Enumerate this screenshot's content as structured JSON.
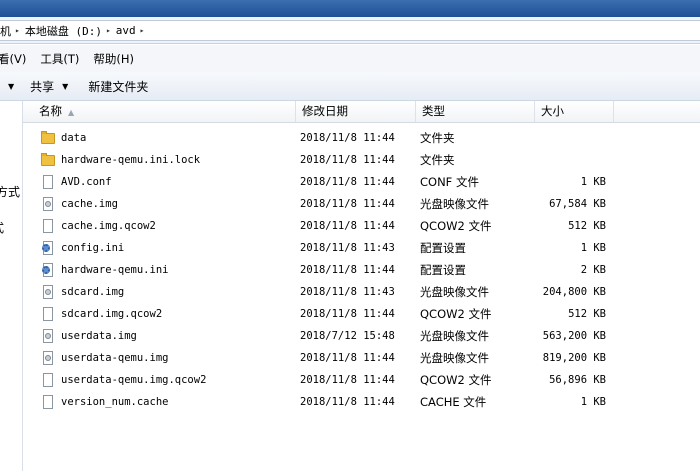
{
  "address": {
    "crumbs": [
      "机",
      "本地磁盘 (D:)",
      "avd"
    ]
  },
  "menu": {
    "items": [
      "看(V)",
      "工具(T)",
      "帮助(H)"
    ]
  },
  "toolbar": {
    "share_label": "共享",
    "new_folder_label": "新建文件夹"
  },
  "navpane": {
    "fragments": [
      "方式",
      "式"
    ]
  },
  "columns": {
    "name": "名称",
    "date": "修改日期",
    "type": "类型",
    "size": "大小"
  },
  "files": [
    {
      "name": "data",
      "date": "2018/11/8 11:44",
      "type": "文件夹",
      "size": "",
      "icon": "folder-icon"
    },
    {
      "name": "hardware-qemu.ini.lock",
      "date": "2018/11/8 11:44",
      "type": "文件夹",
      "size": "",
      "icon": "folder-icon"
    },
    {
      "name": "AVD.conf",
      "date": "2018/11/8 11:44",
      "type": "CONF 文件",
      "size": "1 KB",
      "icon": "file-icon"
    },
    {
      "name": "cache.img",
      "date": "2018/11/8 11:44",
      "type": "光盘映像文件",
      "size": "67,584 KB",
      "icon": "disc-icon"
    },
    {
      "name": "cache.img.qcow2",
      "date": "2018/11/8 11:44",
      "type": "QCOW2 文件",
      "size": "512 KB",
      "icon": "file-icon"
    },
    {
      "name": "config.ini",
      "date": "2018/11/8 11:43",
      "type": "配置设置",
      "size": "1 KB",
      "icon": "gear-icon"
    },
    {
      "name": "hardware-qemu.ini",
      "date": "2018/11/8 11:44",
      "type": "配置设置",
      "size": "2 KB",
      "icon": "gear-icon"
    },
    {
      "name": "sdcard.img",
      "date": "2018/11/8 11:43",
      "type": "光盘映像文件",
      "size": "204,800 KB",
      "icon": "disc-icon"
    },
    {
      "name": "sdcard.img.qcow2",
      "date": "2018/11/8 11:44",
      "type": "QCOW2 文件",
      "size": "512 KB",
      "icon": "file-icon"
    },
    {
      "name": "userdata.img",
      "date": "2018/7/12 15:48",
      "type": "光盘映像文件",
      "size": "563,200 KB",
      "icon": "disc-icon"
    },
    {
      "name": "userdata-qemu.img",
      "date": "2018/11/8 11:44",
      "type": "光盘映像文件",
      "size": "819,200 KB",
      "icon": "disc-icon"
    },
    {
      "name": "userdata-qemu.img.qcow2",
      "date": "2018/11/8 11:44",
      "type": "QCOW2 文件",
      "size": "56,896 KB",
      "icon": "file-icon"
    },
    {
      "name": "version_num.cache",
      "date": "2018/11/8 11:44",
      "type": "CACHE 文件",
      "size": "1 KB",
      "icon": "file-icon"
    }
  ]
}
